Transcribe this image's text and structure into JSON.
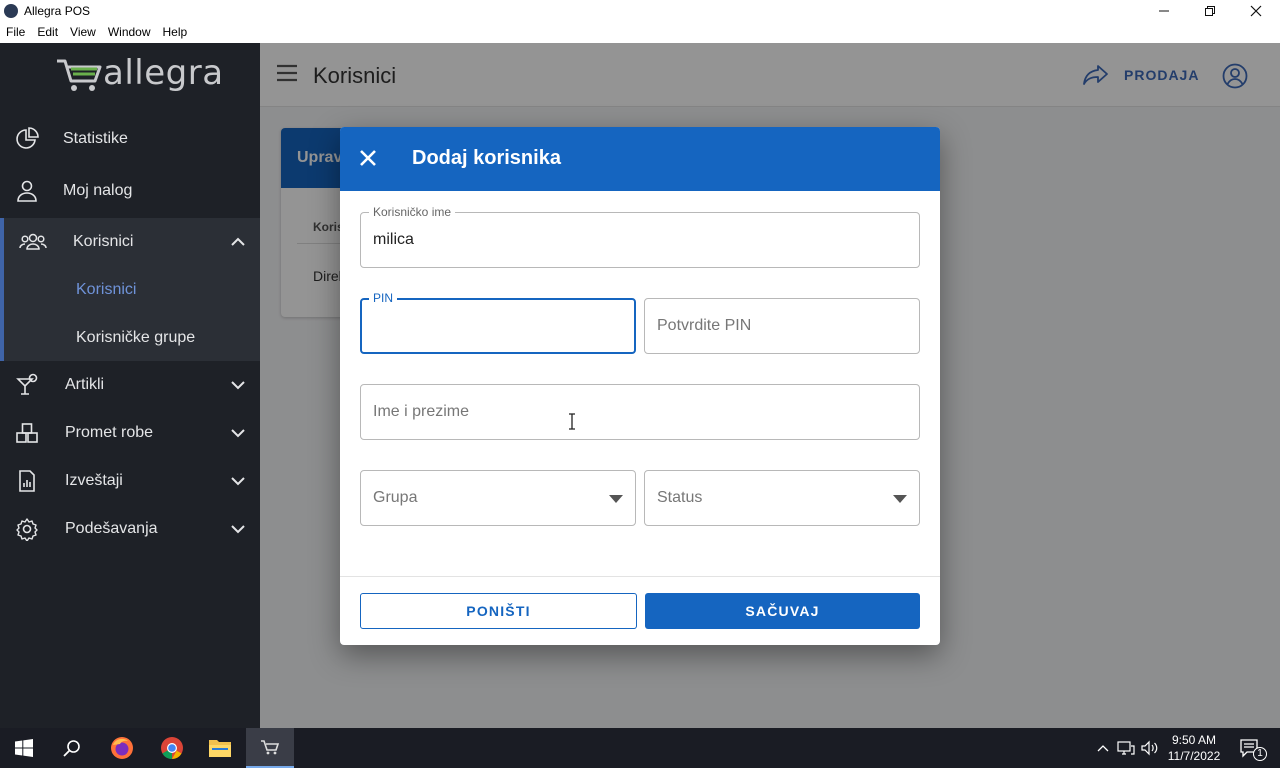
{
  "window": {
    "title": "Allegra POS",
    "minimize": "—",
    "maximize": "❐",
    "close": "✕"
  },
  "menu": [
    "File",
    "Edit",
    "View",
    "Window",
    "Help"
  ],
  "logo": {
    "text": "allegra"
  },
  "sidebar": {
    "items": [
      {
        "label": "Statistike",
        "icon": "pie-chart-icon"
      },
      {
        "label": "Moj nalog",
        "icon": "person-icon"
      },
      {
        "label": "Korisnici",
        "icon": "people-icon",
        "expanded": true
      },
      {
        "label": "Artikli",
        "icon": "cocktail-icon"
      },
      {
        "label": "Promet robe",
        "icon": "boxes-icon"
      },
      {
        "label": "Izveštaji",
        "icon": "report-icon"
      },
      {
        "label": "Podešavanja",
        "icon": "gear-icon"
      }
    ],
    "subitems": [
      {
        "label": "Korisnici",
        "active": true
      },
      {
        "label": "Korisničke grupe",
        "active": false
      }
    ]
  },
  "header": {
    "title": "Korisnici",
    "prodaja": "PRODAJA"
  },
  "background_card": {
    "header": "Uprav",
    "column": "Koris",
    "row": "Direk"
  },
  "dialog": {
    "title": "Dodaj korisnika",
    "username_label": "Korisničko ime",
    "username_value": "milica",
    "pin_label": "PIN",
    "pin_value": "",
    "confirm_pin_placeholder": "Potvrdite PIN",
    "fullname_placeholder": "Ime i prezime",
    "group_placeholder": "Grupa",
    "status_placeholder": "Status",
    "cancel": "PONIŠTI",
    "save": "SAČUVAJ"
  },
  "taskbar": {
    "time": "9:50 AM",
    "date": "11/7/2022",
    "notifications": "1"
  },
  "colors": {
    "primary": "#1565c0",
    "sidebar": "#1e2127",
    "accent": "#6f93d9"
  }
}
